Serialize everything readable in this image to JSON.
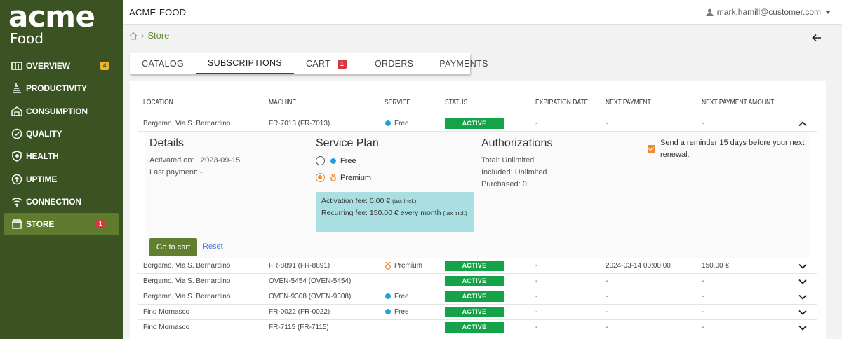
{
  "app": {
    "logo_main": "acme",
    "logo_sub": "Food",
    "title": "ACME-FOOD"
  },
  "user": {
    "email": "mark.hamill@customer.com"
  },
  "breadcrumb": {
    "current": "Store"
  },
  "colors": {
    "sidebar": "#3b5223",
    "active_nav": "#5e7b2e",
    "status_active": "#15a34a",
    "accent_orange": "#f0892f",
    "fee_box": "#a9dfe3"
  },
  "sidebar": {
    "items": [
      {
        "label": "OVERVIEW",
        "icon": "dashboard-icon",
        "badge": "4"
      },
      {
        "label": "PRODUCTIVITY",
        "icon": "productivity-icon"
      },
      {
        "label": "CONSUMPTION",
        "icon": "factory-icon"
      },
      {
        "label": "QUALITY",
        "icon": "quality-badge-icon"
      },
      {
        "label": "HEALTH",
        "icon": "health-shield-icon"
      },
      {
        "label": "UPTIME",
        "icon": "uptime-arrow-icon"
      },
      {
        "label": "CONNECTION",
        "icon": "wifi-icon"
      },
      {
        "label": "STORE",
        "icon": "store-icon",
        "badge": "1",
        "active": true
      }
    ]
  },
  "tabs": [
    {
      "label": "CATALOG"
    },
    {
      "label": "SUBSCRIPTIONS",
      "active": true
    },
    {
      "label": "CART",
      "badge": "1"
    },
    {
      "label": "ORDERS"
    },
    {
      "label": "PAYMENTS"
    }
  ],
  "table": {
    "headers": [
      "LOCATION",
      "MACHINE",
      "SERVICE",
      "STATUS",
      "EXPIRATION DATE",
      "NEXT PAYMENT",
      "NEXT PAYMENT AMOUNT"
    ],
    "rows": [
      {
        "location": "Bergamo, Via S. Bernardino",
        "machine": "FR-7013 (FR-7013)",
        "service": "Free",
        "status": "ACTIVE",
        "expiration": "-",
        "next_payment": "-",
        "amount": "-",
        "expanded": true
      },
      {
        "location": "Bergamo, Via S. Bernardino",
        "machine": "FR-8891 (FR-8891)",
        "service": "Premium",
        "status": "ACTIVE",
        "expiration": "-",
        "next_payment": "2024-03-14 00:00:00",
        "amount": "150.00 €"
      },
      {
        "location": "Bergamo, Via S. Bernardino",
        "machine": "OVEN-5454 (OVEN-5454)",
        "service": "",
        "status": "ACTIVE",
        "expiration": "-",
        "next_payment": "-",
        "amount": "-"
      },
      {
        "location": "Bergamo, Via S. Bernardino",
        "machine": "OVEN-9308 (OVEN-9308)",
        "service": "Free",
        "status": "ACTIVE",
        "expiration": "-",
        "next_payment": "-",
        "amount": "-"
      },
      {
        "location": "Fino Mornasco",
        "machine": "FR-0022 (FR-0022)",
        "service": "Free",
        "status": "ACTIVE",
        "expiration": "-",
        "next_payment": "-",
        "amount": "-"
      },
      {
        "location": "Fino Mornasco",
        "machine": "FR-7115 (FR-7115)",
        "service": "",
        "status": "ACTIVE",
        "expiration": "-",
        "next_payment": "-",
        "amount": "-"
      }
    ]
  },
  "detail": {
    "details_title": "Details",
    "activated_label": "Activated on:",
    "activated_value": "2023-09-15",
    "last_payment": "Last payment: -",
    "plan_title": "Service Plan",
    "plan_free": "Free",
    "plan_premium": "Premium",
    "selected_plan": "Premium",
    "activation_fee": "Activation fee: 0.00 €",
    "recurring_fee": "Recurring fee: 150.00 € every month",
    "tax_note": "(tax incl.)",
    "auth_title": "Authorizations",
    "auth_total": "Total: Unlimited",
    "auth_included": "Included: Unlimited",
    "auth_purchased": "Purchased: 0",
    "reminder_line1": "Send a reminder 15 days before your next",
    "reminder_line2": "renewal.",
    "reminder_checked": true,
    "go_to_cart": "Go to cart",
    "reset": "Reset"
  }
}
